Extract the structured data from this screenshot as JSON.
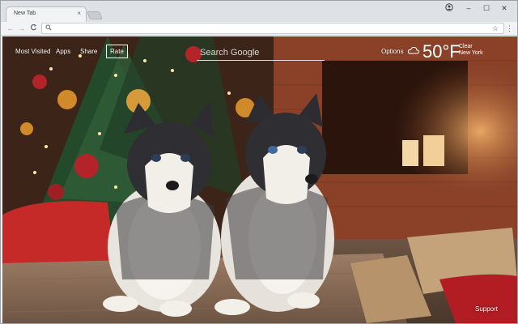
{
  "browser": {
    "tab_title": "New Tab",
    "tab_close": "×",
    "window_controls": {
      "profile": "profile-icon",
      "minimize": "–",
      "maximize": "☐",
      "close": "✕"
    },
    "toolbar": {
      "back": "←",
      "forward": "→",
      "reload": "C",
      "address_value": "",
      "star": "☆",
      "menu": "⋮"
    }
  },
  "newtab": {
    "links": {
      "most_visited": "Most Visited",
      "apps": "Apps",
      "share": "Share",
      "rate": "Rate",
      "options": "Options",
      "support": "Support"
    },
    "search": {
      "placeholder": "Search Google"
    },
    "weather": {
      "temperature": "50°F",
      "condition": "Clear",
      "location": "New York",
      "icon": "cloud-icon"
    }
  },
  "colors": {
    "overlay_text": "#ffffff",
    "tabstrip": "#dee1e6",
    "toolbar": "#f1f3f4"
  }
}
